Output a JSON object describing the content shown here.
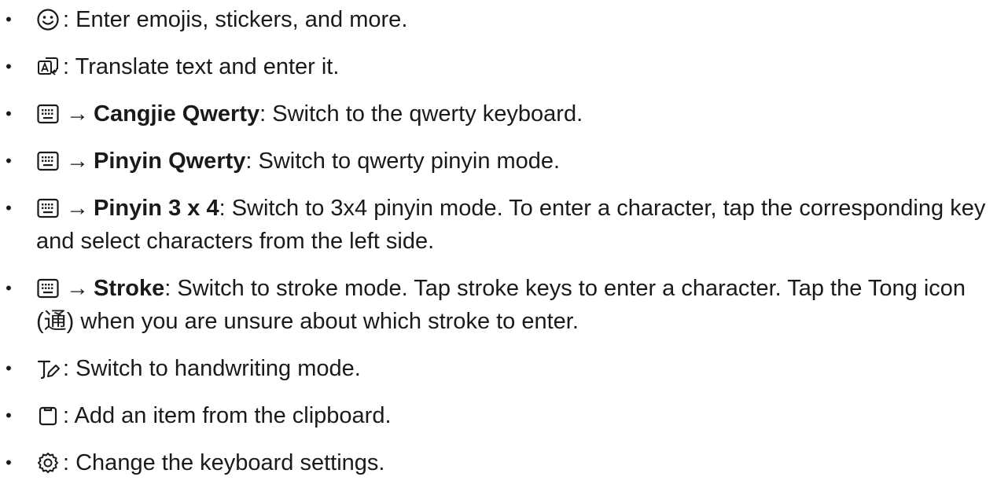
{
  "items": [
    {
      "icon": "smiley-icon",
      "text": ": Enter emojis, stickers, and more."
    },
    {
      "icon": "translate-icon",
      "text": ": Translate text and enter it."
    },
    {
      "icon": "keyboard-icon",
      "arrow": "→",
      "bold": "Cangjie Qwerty",
      "text": ": Switch to the qwerty keyboard."
    },
    {
      "icon": "keyboard-icon",
      "arrow": "→",
      "bold": "Pinyin Qwerty",
      "text": ": Switch to qwerty pinyin mode."
    },
    {
      "icon": "keyboard-icon",
      "arrow": "→",
      "bold": "Pinyin 3 x 4",
      "text": ": Switch to 3x4 pinyin mode. To enter a character, tap the corresponding key and select characters from the left side."
    },
    {
      "icon": "keyboard-icon",
      "arrow": "→",
      "bold": "Stroke",
      "text": ": Switch to stroke mode. Tap stroke keys to enter a character. Tap the Tong icon (通) when you are unsure about which stroke to enter."
    },
    {
      "icon": "handwriting-icon",
      "text": ": Switch to handwriting mode."
    },
    {
      "icon": "clipboard-icon",
      "text": ": Add an item from the clipboard."
    },
    {
      "icon": "gear-icon",
      "text": ": Change the keyboard settings."
    }
  ],
  "bullet": "•"
}
